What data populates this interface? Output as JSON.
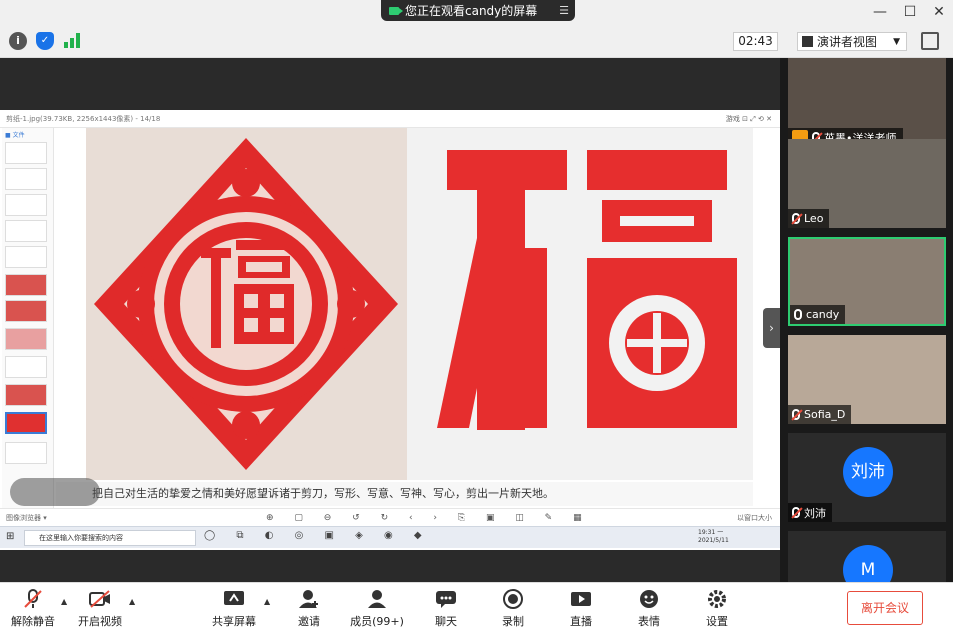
{
  "titlebar": {
    "sharing_notice": "您正在观看candy的屏幕",
    "minimize": "—",
    "maximize": "☐",
    "close": "✕"
  },
  "toolbar": {
    "info_glyph": "i",
    "shield_glyph": "✓",
    "timer": "02:43",
    "view_mode": "演讲者视图",
    "view_caret": "▼"
  },
  "shared_screen": {
    "viewer_title": "剪纸-1.jpg(39.73KB, 2256x1443像素) - 14/18",
    "viewer_right": "游戏 ⊡ ⤢ ⟲ ✕",
    "panel_header": "■ 文件",
    "caption": "把自己对生活的挚爱之情和美好愿望诉诸于剪刀，写形、写意、写神、写心，剪出一片新天地。",
    "viewer_status_left": "图像浏览器 ▾",
    "viewer_status_right": "以窗口大小",
    "viewer_tools": "⊕ ▢ ⊖ ↺ ↻ ‹ › ⎘ ▣ ◫ ✎ ▦",
    "taskbar_search": "在这里输入你要搜索的内容",
    "taskbar_apps": "◯ ⧉ ◐ ◎ ▣ ◈ ◉ ◆",
    "taskbar_clock_time": "19:31 一",
    "taskbar_clock_date": "2021/5/11",
    "collapse": "›",
    "left_image": "paper-cut-fu-diamond",
    "right_image": "paper-cut-fu-character"
  },
  "participants": [
    {
      "name": "茁墨•洋洋老师",
      "muted": true,
      "host": true,
      "type": "video"
    },
    {
      "name": "Leo",
      "muted": true,
      "type": "video"
    },
    {
      "name": "candy",
      "muted": false,
      "type": "video",
      "active": true
    },
    {
      "name": "Sofia_D",
      "muted": true,
      "type": "video"
    },
    {
      "name": "刘沛",
      "muted": true,
      "type": "avatar",
      "avatar_text": "刘沛"
    },
    {
      "name": "",
      "muted": true,
      "type": "avatar",
      "avatar_text": "M"
    }
  ],
  "controls": {
    "unmute": "解除静音",
    "start_video": "开启视频",
    "share_screen": "共享屏幕",
    "invite": "邀请",
    "members": "成员(99+)",
    "chat": "聊天",
    "record": "录制",
    "live": "直播",
    "reactions": "表情",
    "settings": "设置",
    "leave": "离开会议"
  },
  "colors": {
    "accent": "#1677ff",
    "active_border": "#2ecc71",
    "leave": "#e74c3c",
    "papercut_red": "#e02a2a"
  }
}
